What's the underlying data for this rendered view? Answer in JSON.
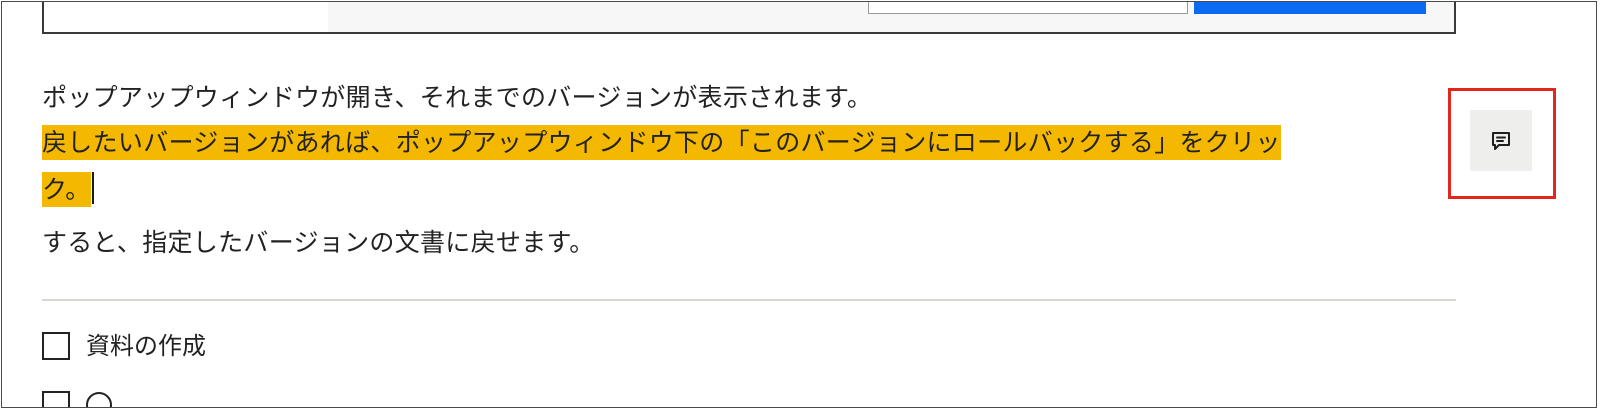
{
  "content": {
    "line1": "ポップアップウィンドウが開き、それまでのバージョンが表示されます。",
    "highlight_line1": "戻したいバージョンがあれば、ポップアップウィンドウ下の「このバージョンにロールバックする」をクリッ",
    "highlight_line2": "ク。",
    "line4": "すると、指定したバージョンの文書に戻せます。"
  },
  "comment_button": {
    "icon": "comment-icon"
  },
  "todos": [
    {
      "label": "資料の作成",
      "checked": false
    },
    {
      "label": "",
      "checked": false
    }
  ],
  "colors": {
    "highlight": "#f5b800",
    "annotation": "#e3261b",
    "primary_button": "#0a6bf2"
  }
}
